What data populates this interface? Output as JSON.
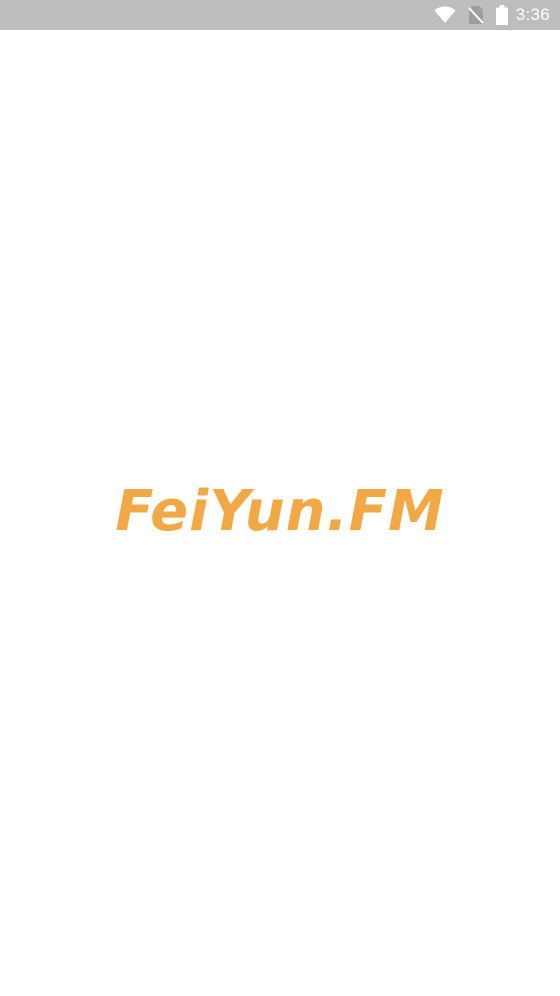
{
  "status_bar": {
    "time": "3:36",
    "icons": [
      "wifi-icon",
      "no-sim-icon",
      "battery-icon"
    ],
    "background_color": "#bdbdbd"
  },
  "splash": {
    "app_name": "FeiYun.FM",
    "brand_color": "#f2a945",
    "background_color": "#ffffff"
  }
}
